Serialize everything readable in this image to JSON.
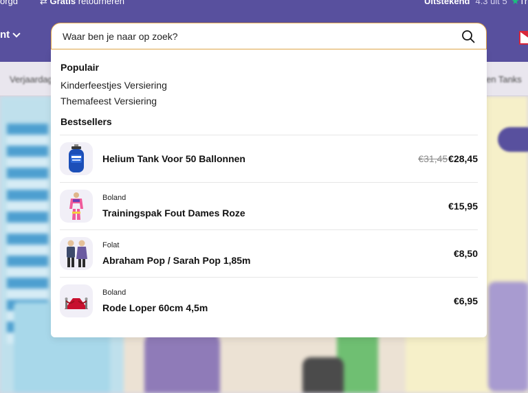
{
  "header": {
    "usp_left": "orgd",
    "usp_return_bold": "Gratis",
    "usp_return_rest": "retourneren",
    "rating_label": "Uitstekend",
    "rating_score": "4.3 uit 5",
    "rating_extra": "Tr",
    "menu_label": "nt"
  },
  "categories": [
    "Verjaardag",
    "en Tanks"
  ],
  "search": {
    "placeholder": "Waar ben je naar op zoek?"
  },
  "popular": {
    "title": "Populair",
    "items": [
      "Kinderfeestjes Versiering",
      "Themafeest Versiering"
    ]
  },
  "bestsellers": {
    "title": "Bestsellers",
    "items": [
      {
        "brand": "",
        "name": "Helium Tank Voor 50 Ballonnen",
        "old_price": "€31,45",
        "price": "€28,45",
        "thumb_icon": "helium-tank-icon"
      },
      {
        "brand": "Boland",
        "name": "Trainingspak Fout Dames Roze",
        "old_price": "",
        "price": "€15,95",
        "thumb_icon": "tracksuit-icon"
      },
      {
        "brand": "Folat",
        "name": "Abraham Pop / Sarah Pop 1,85m",
        "old_price": "",
        "price": "€8,50",
        "thumb_icon": "abraham-sarah-icon"
      },
      {
        "brand": "Boland",
        "name": "Rode Loper 60cm 4,5m",
        "old_price": "",
        "price": "€6,95",
        "thumb_icon": "red-carpet-icon"
      }
    ]
  },
  "colors": {
    "header_bg": "#58509e",
    "search_border": "#e3a84a",
    "thumb_bg": "#f1eff7"
  }
}
